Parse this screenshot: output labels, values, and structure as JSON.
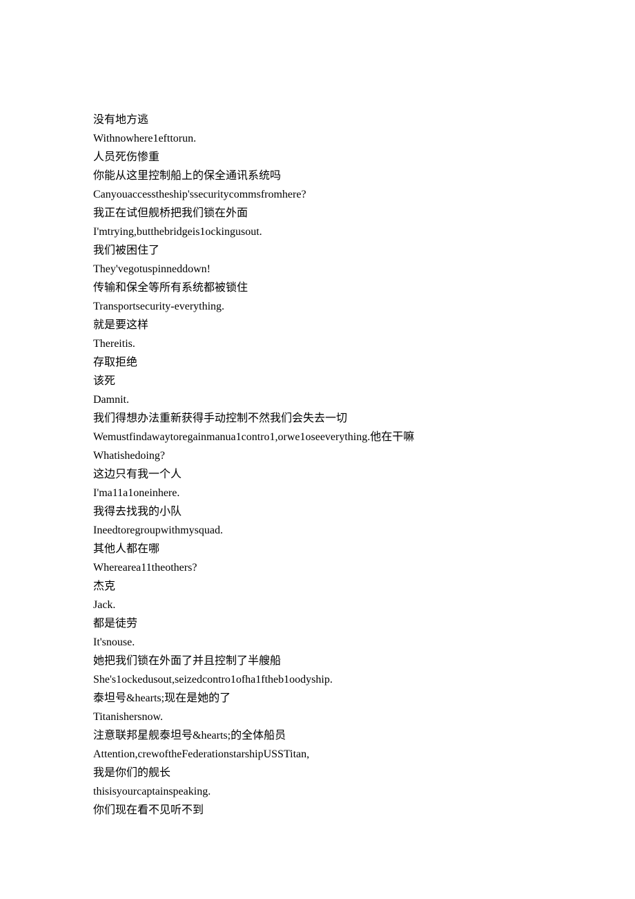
{
  "lines": [
    "没有地方逃",
    "Withnowhere1efttorun.",
    "人员死伤惨重",
    "你能从这里控制船上的保全通讯系统吗",
    "Canyouaccesstheship'ssecuritycommsfromhere?",
    "我正在试但舰桥把我们锁在外面",
    "I'mtrying,butthebridgeis1ockingusout.",
    "我们被困住了",
    "They'vegotuspinneddown!",
    "传输和保全等所有系统都被锁住",
    "Transportsecurity-everything.",
    "就是要这样",
    "Thereitis.",
    "存取拒绝",
    "该死",
    "Damnit.",
    "我们得想办法重新获得手动控制不然我们会失去一切",
    "Wemustfindawaytoregainmanua1contro1,orwe1oseeverything.他在干嘛",
    "Whatishedoing?",
    "这边只有我一个人",
    "I'ma11a1oneinhere.",
    "我得去找我的小队",
    "Ineedtoregroupwithmysquad.",
    "其他人都在哪",
    "Wherearea11theothers?",
    "杰克",
    "Jack.",
    "都是徒劳",
    "It'snouse.",
    "她把我们锁在外面了并且控制了半艘船",
    "She's1ockedusout,seizedcontro1ofha1ftheb1oodyship.",
    "泰坦号&hearts;现在是她的了",
    "Titanishersnow.",
    "注意联邦星舰泰坦号&hearts;的全体船员",
    "Attention,crewoftheFederationstarshipUSSTitan,",
    "我是你们的舰长",
    "thisisyourcaptainspeaking.",
    "你们现在看不见听不到"
  ]
}
